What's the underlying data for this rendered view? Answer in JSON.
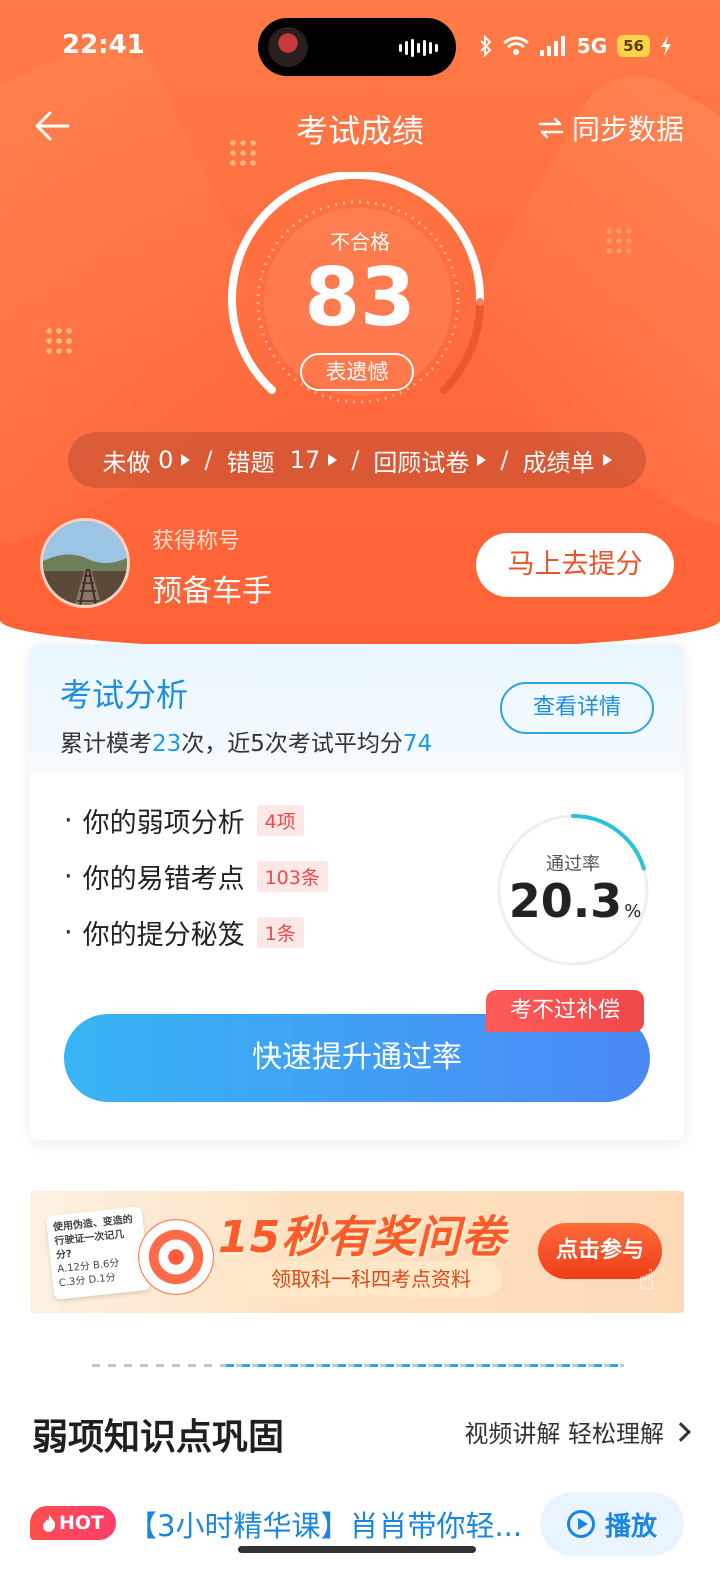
{
  "status_bar": {
    "time": "22:41",
    "network": "5G",
    "battery": "56"
  },
  "nav": {
    "title": "考试成绩",
    "sync_label": "同步数据"
  },
  "score": {
    "status": "不合格",
    "value": "83",
    "tag": "表遗憾"
  },
  "stats": {
    "undone_label": "未做",
    "undone_value": "0",
    "wrong_label": "错题",
    "wrong_value": "17",
    "review_label": "回顾试卷",
    "report_label": "成绩单"
  },
  "title_row": {
    "label": "获得称号",
    "title": "预备车手",
    "button": "马上去提分"
  },
  "analysis": {
    "title": "考试分析",
    "sub_prefix": "累计模考",
    "mock_count": "23",
    "sub_mid": "次，近5次考试平均分",
    "avg_score": "74",
    "detail_button": "查看详情",
    "items": [
      {
        "label": "你的弱项分析",
        "badge": "4项"
      },
      {
        "label": "你的易错考点",
        "badge": "103条"
      },
      {
        "label": "你的提分秘笈",
        "badge": "1条"
      }
    ],
    "pass_rate_label": "通过率",
    "pass_rate_value": "20.3",
    "pass_rate_unit": "%",
    "pass_rate_fraction": 0.203,
    "cta_label": "快速提升通过率",
    "cta_badge": "考不过补偿"
  },
  "banner": {
    "headline": "15秒有奖问卷",
    "subline": "领取科一科四考点资料",
    "button": "点击参与",
    "paper_question": "使用伪造、变造的行驶证一次记几分?",
    "paper_options": [
      "A.12分",
      "B.6分",
      "C.3分",
      "D.1分"
    ]
  },
  "weak_section": {
    "title": "弱项知识点巩固",
    "more_label": "视频讲解 轻松理解"
  },
  "course": {
    "hot_label": "HOT",
    "title": "【3小时精华课】肖肖带你轻...",
    "play_label": "播放"
  },
  "colors": {
    "hero": "#ff6a3d",
    "accent_blue": "#1d8fe0",
    "badge_red": "#ef4a4a"
  }
}
